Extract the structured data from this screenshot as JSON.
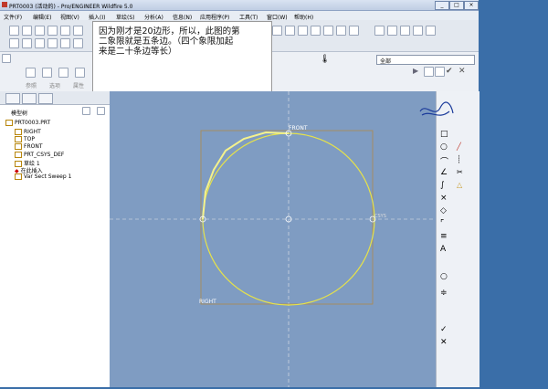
{
  "window": {
    "title": "PRT0003 (活动的) - Pro/ENGINEER Wildfire 5.0",
    "min_label": "_",
    "max_label": "□",
    "close_label": "×"
  },
  "menu": [
    "文件(F)",
    "编辑(E)",
    "视图(V)",
    "插入(I)",
    "草绘(S)",
    "分析(A)",
    "信息(N)",
    "应用程序(P)",
    "工具(T)",
    "窗口(W)",
    "帮助(H)"
  ],
  "note": {
    "lines": [
      "因为刚才是20边形，所以，此图的第",
      "二象限就是五条边。（四个象限加起",
      "来是二十条边等长）"
    ]
  },
  "dashboard": {
    "labels": [
      "参照",
      "选项",
      "属性"
    ],
    "filter_value": "全部"
  },
  "model_tree": {
    "header": "模型树",
    "items": [
      "PRT0003.PRT",
      "RIGHT",
      "TOP",
      "FRONT",
      "PRT_CSYS_DEF",
      "草绘 1",
      "在此插入",
      "Var Sect Sweep 1"
    ]
  },
  "sketch": {
    "label_front": "FRONT",
    "label_right_bottom": "RIGHT",
    "label_sys": "CSYS",
    "sides_total": 20,
    "sides_in_quadrant": 5
  },
  "right_tools": [
    "□",
    "○",
    "⌒",
    "∠",
    "∫",
    "×",
    "◇",
    "⌜",
    "≡",
    "A",
    "○",
    "≑",
    "✓",
    "✕"
  ],
  "colors": {
    "canvas": "#7f9cc2",
    "sketch_line": "#e6e24a",
    "section_frame": "#b08a4a"
  }
}
